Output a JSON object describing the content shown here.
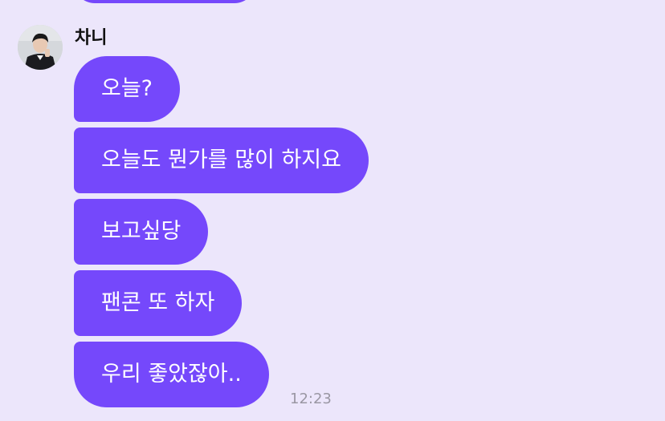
{
  "chat": {
    "sender": {
      "name": "차니"
    },
    "messages": [
      {
        "text": "오늘?"
      },
      {
        "text": "오늘도 뭔가를 많이 하지요"
      },
      {
        "text": "보고싶당"
      },
      {
        "text": "팬콘 또 하자"
      },
      {
        "text": "우리 좋았잖아.."
      }
    ],
    "timestamp": "12:23"
  },
  "colors": {
    "background": "#ece6fb",
    "bubble": "#7548fb",
    "bubble_text": "#ffffff",
    "timestamp": "#9a97a3"
  }
}
